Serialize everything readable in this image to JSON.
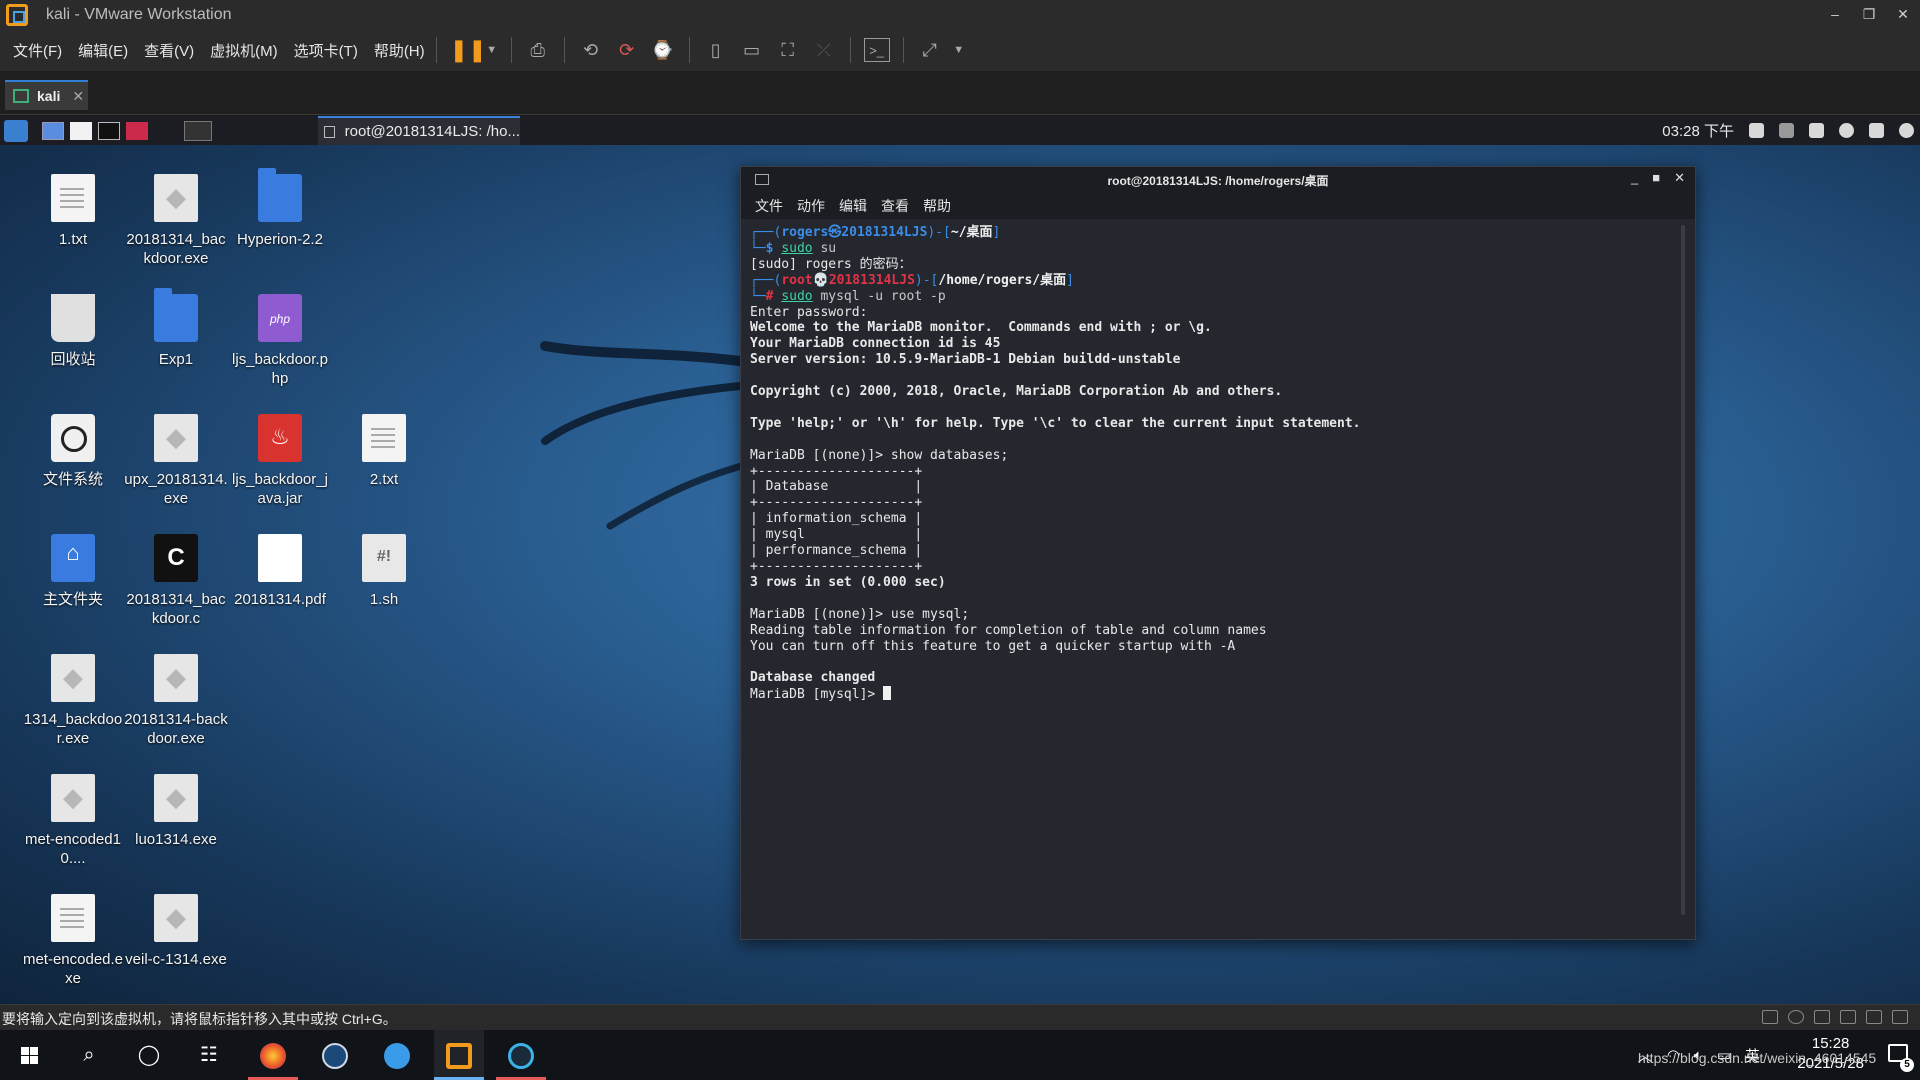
{
  "vmware": {
    "title": "kali - VMware Workstation",
    "menus": [
      "文件(F)",
      "编辑(E)",
      "查看(V)",
      "虚拟机(M)",
      "选项卡(T)",
      "帮助(H)"
    ],
    "tab_label": "kali",
    "status_text": "要将输入定向到该虚拟机，请将鼠标指针移入其中或按 Ctrl+G。"
  },
  "kali_panel": {
    "task_button": "root@20181314LJS: /ho...",
    "clock": "03:28 下午"
  },
  "desktop_icons": [
    {
      "label": "1.txt",
      "icon": "text-file-icon"
    },
    {
      "label": "20181314_backdoor.exe",
      "icon": "exe-file-icon"
    },
    {
      "label": "Hyperion-2.2",
      "icon": "folder-icon"
    },
    {
      "label": "回收站",
      "icon": "trash-icon"
    },
    {
      "label": "Exp1",
      "icon": "folder-icon"
    },
    {
      "label": "ljs_backdoor.php",
      "icon": "php-file-icon"
    },
    {
      "label": "文件系统",
      "icon": "filesystem-icon"
    },
    {
      "label": "upx_20181314.exe",
      "icon": "exe-file-icon"
    },
    {
      "label": "ljs_backdoor_java.jar",
      "icon": "jar-file-icon"
    },
    {
      "label": "2.txt",
      "icon": "text-file-icon"
    },
    {
      "label": "主文件夹",
      "icon": "home-folder-icon"
    },
    {
      "label": "20181314_backdoor.c",
      "icon": "c-file-icon"
    },
    {
      "label": "20181314.pdf",
      "icon": "pdf-file-icon"
    },
    {
      "label": "1.sh",
      "icon": "shell-script-icon"
    },
    {
      "label": "1314_backdoor.exe",
      "icon": "exe-file-icon"
    },
    {
      "label": "20181314-backdoor.exe",
      "icon": "exe-file-icon"
    },
    {
      "label": "met-encoded10....",
      "icon": "exe-file-icon"
    },
    {
      "label": "luo1314.exe",
      "icon": "exe-file-icon"
    },
    {
      "label": "met-encoded.exe",
      "icon": "text-file-icon"
    },
    {
      "label": "veil-c-1314.exe",
      "icon": "exe-file-icon"
    }
  ],
  "terminal": {
    "title": "root@20181314LJS: /home/rogers/桌面",
    "menus": [
      "文件",
      "动作",
      "编辑",
      "查看",
      "帮助"
    ],
    "prompt1": {
      "user": "rogers",
      "at": "㉿",
      "host": "20181314LJS",
      "path": "~/桌面"
    },
    "cmd1": {
      "main": "sudo",
      "rest": "su"
    },
    "sudo_prompt": "[sudo] rogers 的密码：",
    "prompt2": {
      "user": "root",
      "at": "💀",
      "host": "20181314LJS",
      "path": "/home/rogers/桌面"
    },
    "cmd2": {
      "main": "sudo",
      "rest": "mysql -u root -p"
    },
    "lines_a": [
      "Enter password:",
      "Welcome to the MariaDB monitor.  Commands end with ; or \\g.",
      "Your MariaDB connection id is 45",
      "Server version: 10.5.9-MariaDB-1 Debian buildd-unstable",
      "",
      "Copyright (c) 2000, 2018, Oracle, MariaDB Corporation Ab and others.",
      "",
      "Type 'help;' or '\\h' for help. Type '\\c' to clear the current input statement.",
      "",
      "MariaDB [(none)]> show databases;",
      "+--------------------+",
      "| Database           |",
      "+--------------------+",
      "| information_schema |",
      "| mysql              |",
      "| performance_schema |",
      "+--------------------+",
      "3 rows in set (0.000 sec)",
      "",
      "MariaDB [(none)]> use mysql;",
      "Reading table information for completion of table and column names",
      "You can turn off this feature to get a quicker startup with -A",
      "",
      "Database changed"
    ],
    "bold_lines": [
      1,
      2,
      3,
      5,
      7,
      17,
      23
    ],
    "final_prompt": "MariaDB [mysql]> "
  },
  "windows_taskbar": {
    "time": "15:28",
    "date": "2021/5/28",
    "ime": "英",
    "watermark": "https://blog.csdn.net/weixin_46014545",
    "notification_count": "5"
  }
}
